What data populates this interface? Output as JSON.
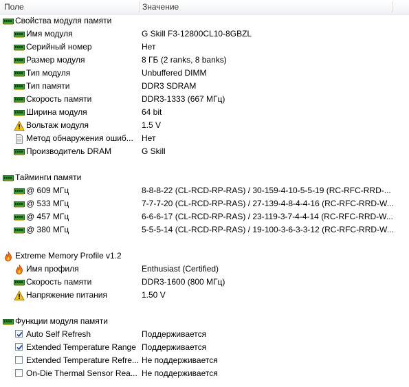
{
  "header": {
    "col_field": "Поле",
    "col_value": "Значение"
  },
  "section_module": {
    "title": "Свойства модуля памяти",
    "rows": [
      {
        "field": "Имя модуля",
        "value": "G Skill F3-12800CL10-8GBZL",
        "icon": "memory-icon"
      },
      {
        "field": "Серийный номер",
        "value": "Нет",
        "icon": "memory-icon"
      },
      {
        "field": "Размер модуля",
        "value": "8 ГБ (2 ranks, 8 banks)",
        "icon": "memory-icon"
      },
      {
        "field": "Тип модуля",
        "value": "Unbuffered DIMM",
        "icon": "memory-icon"
      },
      {
        "field": "Тип памяти",
        "value": "DDR3 SDRAM",
        "icon": "memory-icon"
      },
      {
        "field": "Скорость памяти",
        "value": "DDR3-1333 (667 МГц)",
        "icon": "memory-icon"
      },
      {
        "field": "Ширина модуля",
        "value": "64 bit",
        "icon": "memory-icon"
      },
      {
        "field": "Вольтаж модуля",
        "value": "1.5 V",
        "icon": "warning-icon"
      },
      {
        "field": "Метод обнаружения ошиб...",
        "value": "Нет",
        "icon": "document-icon"
      },
      {
        "field": "Производитель DRAM",
        "value": "G Skill",
        "icon": "memory-icon"
      }
    ]
  },
  "section_timings": {
    "title": "Тайминги памяти",
    "rows": [
      {
        "field": "@ 609 МГц",
        "value": "8-8-8-22  (CL-RCD-RP-RAS) / 30-159-4-10-5-5-19  (RC-RFC-RRD-..."
      },
      {
        "field": "@ 533 МГц",
        "value": "7-7-7-20  (CL-RCD-RP-RAS) / 27-139-4-8-4-4-16  (RC-RFC-RRD-W..."
      },
      {
        "field": "@ 457 МГц",
        "value": "6-6-6-17  (CL-RCD-RP-RAS) / 23-119-3-7-4-4-14  (RC-RFC-RRD-W..."
      },
      {
        "field": "@ 380 МГц",
        "value": "5-5-5-14  (CL-RCD-RP-RAS) / 19-100-3-6-3-3-12  (RC-RFC-RRD-W..."
      }
    ]
  },
  "section_xmp": {
    "title": "Extreme Memory Profile v1.2",
    "rows": [
      {
        "field": "Имя профиля",
        "value": "Enthusiast (Certified)",
        "icon": "flame-icon"
      },
      {
        "field": "Скорость памяти",
        "value": "DDR3-1600 (800 МГц)",
        "icon": "memory-icon"
      },
      {
        "field": "Напряжение питания",
        "value": "1.50 V",
        "icon": "warning-icon"
      }
    ]
  },
  "section_features": {
    "title": "Функции модуля памяти",
    "rows": [
      {
        "field": "Auto Self Refresh",
        "value": "Поддерживается",
        "checked": true
      },
      {
        "field": "Extended Temperature Range",
        "value": "Поддерживается",
        "checked": true
      },
      {
        "field": "Extended Temperature Refre...",
        "value": "Не поддерживается",
        "checked": false
      },
      {
        "field": "On-Die Thermal Sensor Rea...",
        "value": "Не поддерживается",
        "checked": false
      }
    ]
  },
  "colors": {
    "memory_green": "#2e8b2e",
    "warning_yellow": "#f2c200",
    "flame_orange": "#f07a10",
    "check_blue": "#1f4f9a"
  }
}
